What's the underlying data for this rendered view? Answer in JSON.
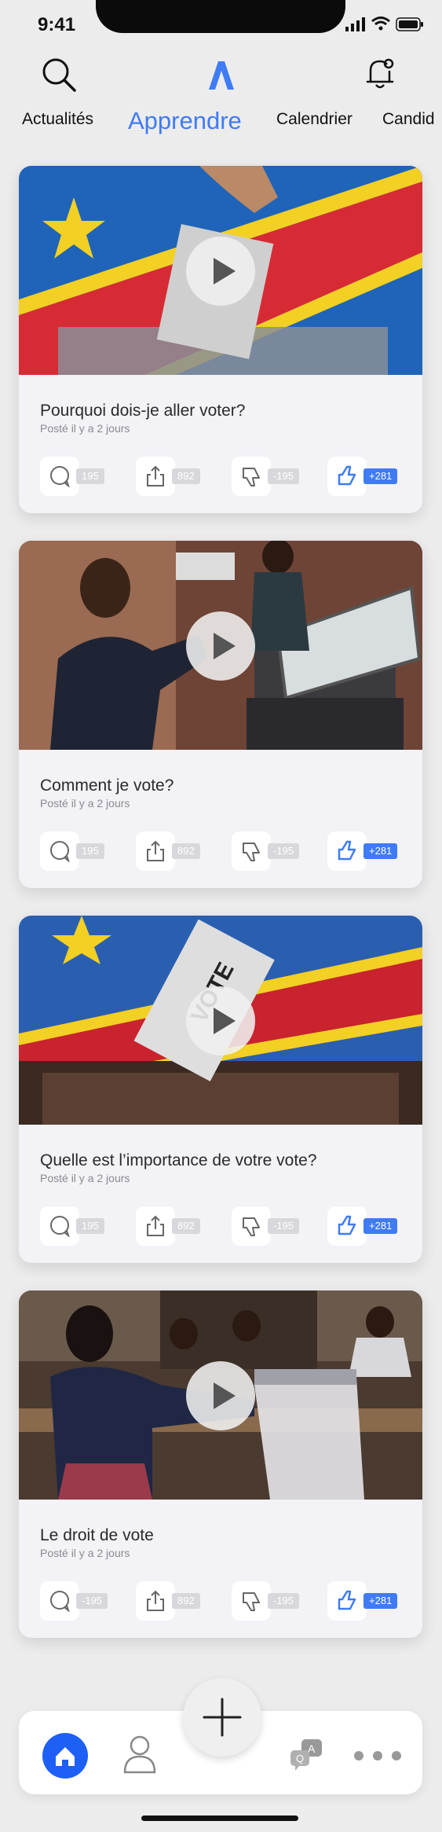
{
  "status_bar": {
    "time": "9:41"
  },
  "top_bar": {
    "search_icon": "search-icon",
    "logo_icon": "logo-icon",
    "bell_icon": "bell-icon"
  },
  "tabs": [
    {
      "label": "Actualités",
      "active": false
    },
    {
      "label": "Apprendre",
      "active": true
    },
    {
      "label": "Calendrier",
      "active": false
    },
    {
      "label": "Candid",
      "active": false
    }
  ],
  "accent_color": "#3f7bf5",
  "cards": [
    {
      "title": "Pourquoi dois-je aller voter?",
      "posted": "Posté il y a 2 jours",
      "comments": "195",
      "shares": "892",
      "dislikes": "-195",
      "likes": "+281"
    },
    {
      "title": "Comment je vote?",
      "posted": "Posté il y a 2 jours",
      "comments": "195",
      "shares": "892",
      "dislikes": "-195",
      "likes": "+281"
    },
    {
      "title": "Quelle est l’importance de votre vote?",
      "posted": "Posté il y a 2 jours",
      "comments": "195",
      "shares": "892",
      "dislikes": "-195",
      "likes": "+281"
    },
    {
      "title": "Le droit de vote",
      "posted": "Posté il y a 2 jours",
      "comments": "-195",
      "shares": "892",
      "dislikes": "-195",
      "likes": "+281"
    }
  ],
  "card3_image_text": "VOTE",
  "bottom_nav": {
    "items": [
      "home-icon",
      "profile-icon",
      "qa-icon",
      "more-icon"
    ],
    "fab_icon": "plus-icon",
    "qa_letters": [
      "A",
      "Q"
    ]
  }
}
